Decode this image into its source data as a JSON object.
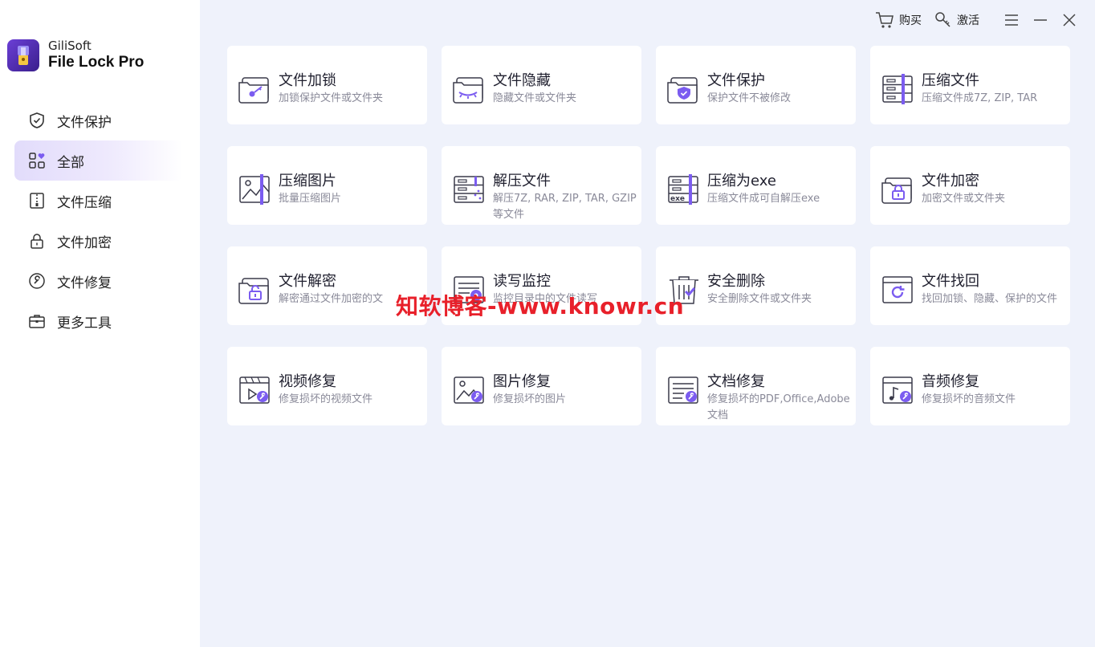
{
  "brand": {
    "sub": "GiliSoft",
    "title": "File Lock Pro"
  },
  "nav": {
    "items": [
      {
        "label": "文件保护"
      },
      {
        "label": "全部"
      },
      {
        "label": "文件压缩"
      },
      {
        "label": "文件加密"
      },
      {
        "label": "文件修复"
      },
      {
        "label": "更多工具"
      }
    ],
    "active": "全部"
  },
  "topbar": {
    "buy_label": "购买",
    "activate_label": "激活"
  },
  "cards": [
    {
      "title": "文件加锁",
      "desc": "加锁保护文件或文件夹"
    },
    {
      "title": "文件隐藏",
      "desc": "隐藏文件或文件夹"
    },
    {
      "title": "文件保护",
      "desc": "保护文件不被修改"
    },
    {
      "title": "压缩文件",
      "desc": "压缩文件成7Z, ZIP, TAR"
    },
    {
      "title": "压缩图片",
      "desc": "批量压缩图片"
    },
    {
      "title": "解压文件",
      "desc": "解压7Z, RAR, ZIP, TAR, GZIP等文件"
    },
    {
      "title": "压缩为exe",
      "desc": "压缩文件成可自解压exe"
    },
    {
      "title": "文件加密",
      "desc": "加密文件或文件夹"
    },
    {
      "title": "文件解密",
      "desc": "解密通过文件加密的文"
    },
    {
      "title": "读写监控",
      "desc": "监控目录中的文件读写"
    },
    {
      "title": "安全删除",
      "desc": "安全删除文件或文件夹"
    },
    {
      "title": "文件找回",
      "desc": "找回加锁、隐藏、保护的文件"
    },
    {
      "title": "视频修复",
      "desc": "修复损坏的视频文件"
    },
    {
      "title": "图片修复",
      "desc": "修复损坏的图片"
    },
    {
      "title": "文档修复",
      "desc": "修复损坏的PDF,Office,Adobe文档"
    },
    {
      "title": "音频修复",
      "desc": "修复损坏的音频文件"
    }
  ],
  "watermark": "知软博客-www.knowr.cn",
  "colors": {
    "accent": "#7b5cf0",
    "background": "#eff2fb",
    "active_nav": "#e2dcfb",
    "watermark": "#e8202a"
  }
}
